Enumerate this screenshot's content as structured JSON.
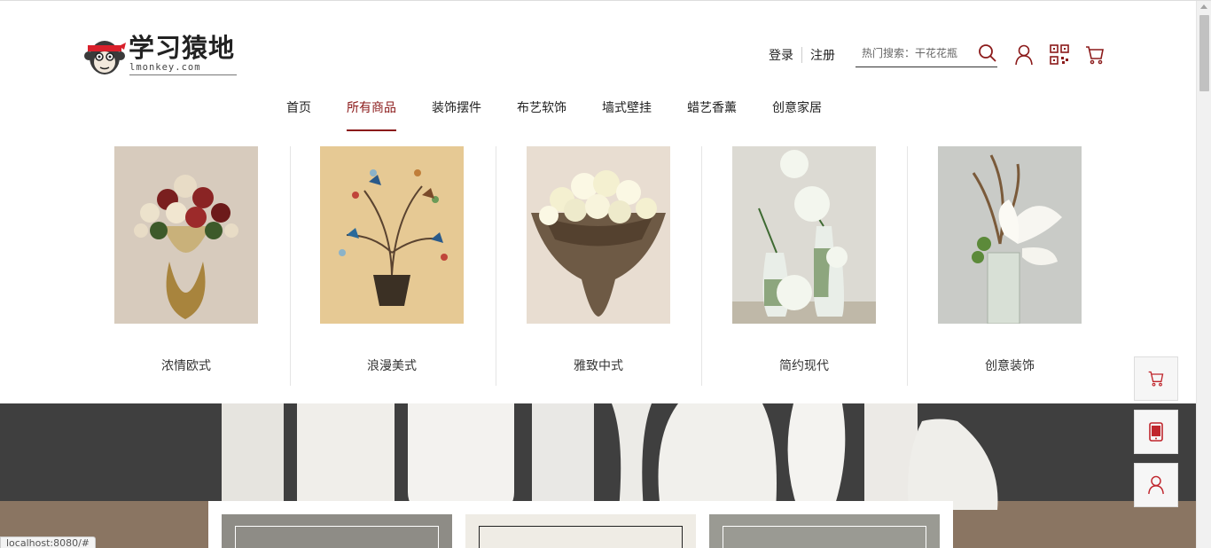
{
  "brand": {
    "name": "学习猿地",
    "domain": "lmonkey.com"
  },
  "auth": {
    "login": "登录",
    "register": "注册"
  },
  "search": {
    "placeholder": "热门搜索：干花花瓶"
  },
  "nav": {
    "items": [
      {
        "label": "首页"
      },
      {
        "label": "所有商品",
        "active": true
      },
      {
        "label": "装饰摆件"
      },
      {
        "label": "布艺软饰"
      },
      {
        "label": "墙式壁挂"
      },
      {
        "label": "蜡艺香薰"
      },
      {
        "label": "创意家居"
      }
    ]
  },
  "categories": [
    {
      "label": "浓情欧式"
    },
    {
      "label": "浪漫美式"
    },
    {
      "label": "雅致中式"
    },
    {
      "label": "简约现代"
    },
    {
      "label": "创意装饰"
    }
  ],
  "status_bar": {
    "url": "localhost:8080/#"
  },
  "colors": {
    "accent": "#8b1a1a",
    "nav_active": "#8b1a1a"
  }
}
